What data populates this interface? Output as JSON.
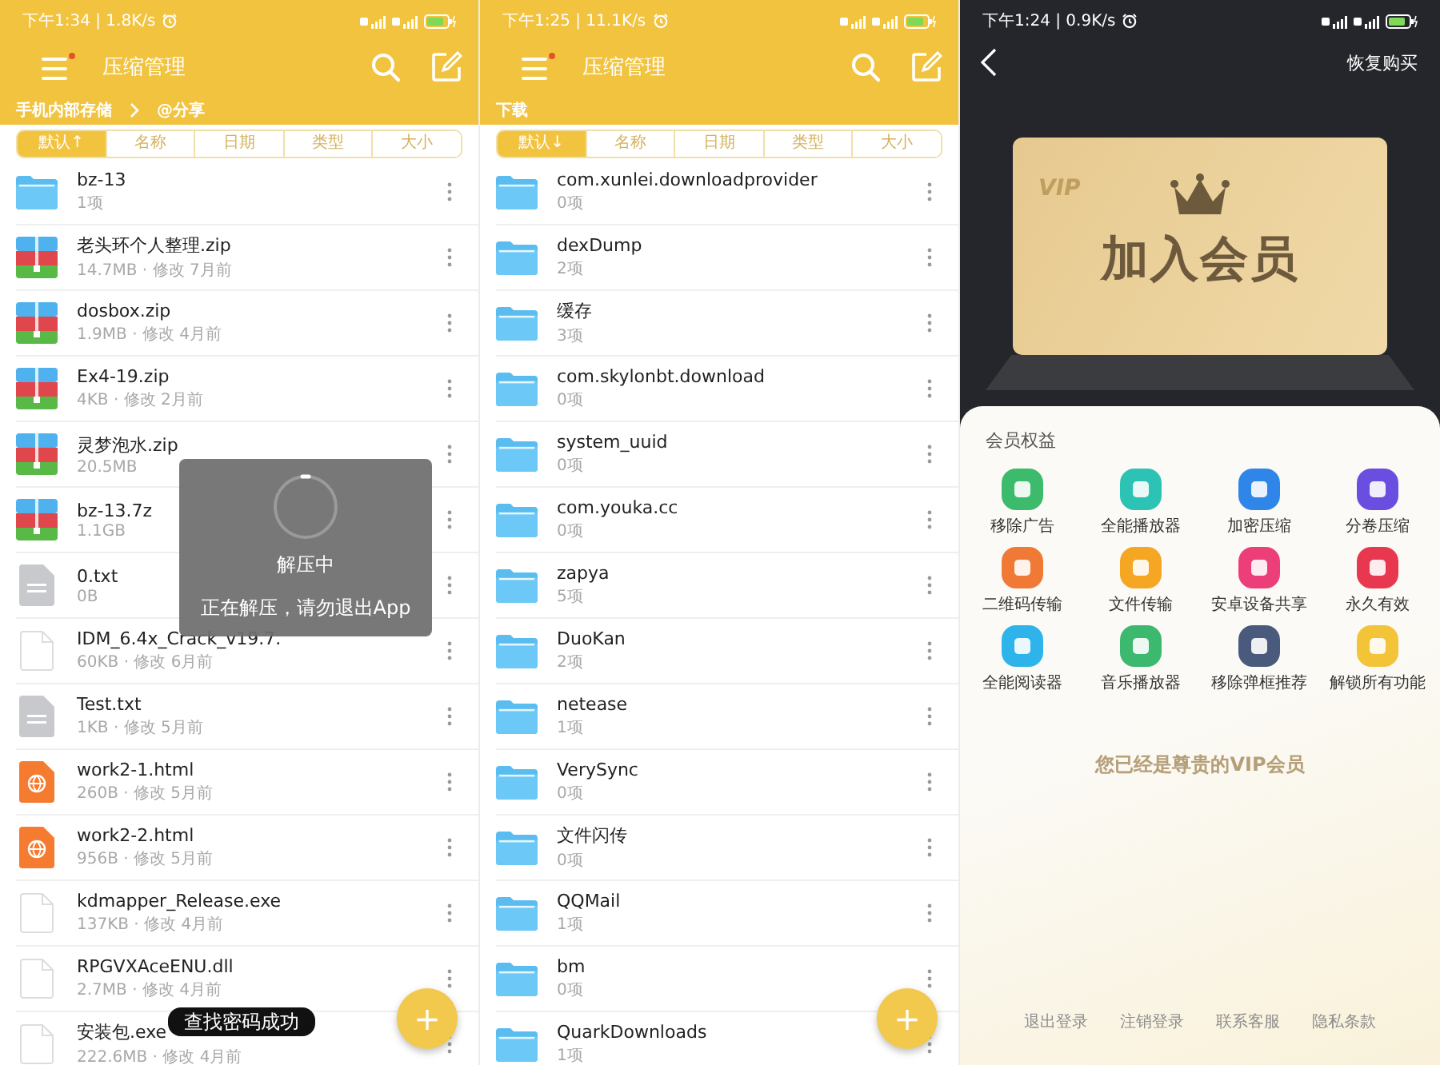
{
  "screens": [
    {
      "kind": "file_manager",
      "status": "下午1:34 | 1.8K/s",
      "title": "压缩管理",
      "breadcrumb": [
        "手机内部存储",
        "@分享"
      ],
      "sort_tabs": [
        {
          "label": "默认↑",
          "selected": true
        },
        {
          "label": "名称",
          "selected": false
        },
        {
          "label": "日期",
          "selected": false
        },
        {
          "label": "类型",
          "selected": false
        },
        {
          "label": "大小",
          "selected": false
        }
      ],
      "files": [
        {
          "kind": "folder",
          "name": "bz-13",
          "meta": "1项"
        },
        {
          "kind": "zip",
          "name": "老头环个人整理.zip",
          "meta": "14.7MB · 修改 7月前"
        },
        {
          "kind": "zip",
          "name": "dosbox.zip",
          "meta": "1.9MB · 修改 4月前"
        },
        {
          "kind": "zip",
          "name": "Ex4-19.zip",
          "meta": "4KB · 修改 2月前"
        },
        {
          "kind": "zip",
          "name": "灵梦泡水.zip",
          "meta": "20.5MB"
        },
        {
          "kind": "zip",
          "name": "bz-13.7z",
          "meta": "1.1GB"
        },
        {
          "kind": "txt",
          "name": "0.txt",
          "meta": "0B"
        },
        {
          "kind": "file",
          "name": "IDM_6.4x_Crack_v19.7.",
          "meta": "60KB · 修改 6月前"
        },
        {
          "kind": "txt",
          "name": "Test.txt",
          "meta": "1KB · 修改 5月前"
        },
        {
          "kind": "html",
          "name": "work2-1.html",
          "meta": "260B · 修改 5月前"
        },
        {
          "kind": "html",
          "name": "work2-2.html",
          "meta": "956B · 修改 5月前"
        },
        {
          "kind": "file",
          "name": "kdmapper_Release.exe",
          "meta": "137KB · 修改 4月前"
        },
        {
          "kind": "file",
          "name": "RPGVXAceENU.dll",
          "meta": "2.7MB · 修改 4月前"
        },
        {
          "kind": "file",
          "name": "安装包.exe",
          "meta": "222.6MB · 修改 4月前"
        }
      ],
      "dialog": {
        "title": "解压中",
        "message": "正在解压，请勿退出App"
      },
      "toast": "查找密码成功",
      "fab": "+"
    },
    {
      "kind": "file_manager",
      "status": "下午1:25 | 11.1K/s",
      "title": "压缩管理",
      "breadcrumb": [
        "下载"
      ],
      "sort_tabs": [
        {
          "label": "默认↓",
          "selected": true
        },
        {
          "label": "名称",
          "selected": false
        },
        {
          "label": "日期",
          "selected": false
        },
        {
          "label": "类型",
          "selected": false
        },
        {
          "label": "大小",
          "selected": false
        }
      ],
      "files": [
        {
          "kind": "folder",
          "name": "com.xunlei.downloadprovider",
          "meta": "0项"
        },
        {
          "kind": "folder",
          "name": "dexDump",
          "meta": "2项"
        },
        {
          "kind": "folder",
          "name": "缓存",
          "meta": "3项"
        },
        {
          "kind": "folder",
          "name": "com.skylonbt.download",
          "meta": "0项"
        },
        {
          "kind": "folder",
          "name": "system_uuid",
          "meta": "0项"
        },
        {
          "kind": "folder",
          "name": "com.youka.cc",
          "meta": "0项"
        },
        {
          "kind": "folder",
          "name": "zapya",
          "meta": "5项"
        },
        {
          "kind": "folder",
          "name": "DuoKan",
          "meta": "2项"
        },
        {
          "kind": "folder",
          "name": "netease",
          "meta": "1项"
        },
        {
          "kind": "folder",
          "name": "VerySync",
          "meta": "0项"
        },
        {
          "kind": "folder",
          "name": "文件闪传",
          "meta": "0项"
        },
        {
          "kind": "folder",
          "name": "QQMail",
          "meta": "1项"
        },
        {
          "kind": "folder",
          "name": "bm",
          "meta": "0项"
        },
        {
          "kind": "folder",
          "name": "QuarkDownloads",
          "meta": "1项"
        }
      ],
      "fab": "+"
    },
    {
      "kind": "membership",
      "status": "下午1:24 | 0.9K/s",
      "restore": "恢复购买",
      "card_badge": "VIP",
      "card_title": "加入会员",
      "section_title": "会员权益",
      "benefits": [
        {
          "label": "移除广告",
          "color": "#3dbb6c"
        },
        {
          "label": "全能播放器",
          "color": "#2cc3b5"
        },
        {
          "label": "加密压缩",
          "color": "#2f86e8"
        },
        {
          "label": "分卷压缩",
          "color": "#6a4ee0"
        },
        {
          "label": "二维码传输",
          "color": "#f07a35"
        },
        {
          "label": "文件传输",
          "color": "#f5a623"
        },
        {
          "label": "安卓设备共享",
          "color": "#ec3f7a"
        },
        {
          "label": "永久有效",
          "color": "#e8384f"
        },
        {
          "label": "全能阅读器",
          "color": "#2eb4ea"
        },
        {
          "label": "音乐播放器",
          "color": "#3db86f"
        },
        {
          "label": "移除弹框推荐",
          "color": "#4a5a7c"
        },
        {
          "label": "解锁所有功能",
          "color": "#f3c338"
        }
      ],
      "message": "您已经是尊贵的VIP会员",
      "footer_links": [
        "退出登录",
        "注销登录",
        "联系客服",
        "隐私条款"
      ]
    }
  ]
}
